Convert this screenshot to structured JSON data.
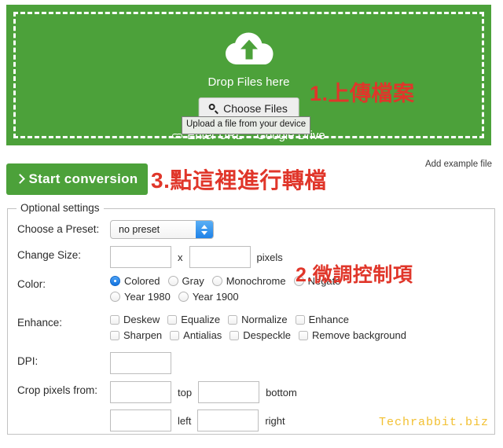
{
  "upload": {
    "icon": "cloud-upload-icon",
    "drop_label": "Drop Files here",
    "choose_files_label": "Choose Files",
    "choose_files_icon": "search-icon",
    "sources": [
      {
        "label": "Enter URL",
        "icon": "link-icon"
      },
      {
        "label": "Google Drive",
        "icon": "drive-icon"
      }
    ],
    "tooltip": "Upload a file from your device",
    "green": "#4ca13a"
  },
  "actions": {
    "start_conversion_label": "Start conversion",
    "start_conversion_icon": "chevron-right-icon",
    "add_example_file_label": "Add example file"
  },
  "annotations": {
    "accent": "#e0362a",
    "step1": "1.上傳檔案",
    "step2": "2.微調控制項",
    "step3": "3.點這裡進行轉檔"
  },
  "settings": {
    "legend": "Optional settings",
    "preset": {
      "label": "Choose a Preset:",
      "value": "no preset"
    },
    "change_size": {
      "label": "Change Size:",
      "width_value": "",
      "height_value": "",
      "separator": "x",
      "unit": "pixels"
    },
    "color": {
      "label": "Color:",
      "options": [
        {
          "name": "Colored",
          "checked": true
        },
        {
          "name": "Gray",
          "checked": false
        },
        {
          "name": "Monochrome",
          "checked": false
        },
        {
          "name": "Negate",
          "checked": false
        },
        {
          "name": "Year 1980",
          "checked": false
        },
        {
          "name": "Year 1900",
          "checked": false
        }
      ]
    },
    "enhance": {
      "label": "Enhance:",
      "options": [
        {
          "name": "Deskew",
          "checked": false
        },
        {
          "name": "Equalize",
          "checked": false
        },
        {
          "name": "Normalize",
          "checked": false
        },
        {
          "name": "Enhance",
          "checked": false
        },
        {
          "name": "Sharpen",
          "checked": false
        },
        {
          "name": "Antialias",
          "checked": false
        },
        {
          "name": "Despeckle",
          "checked": false
        },
        {
          "name": "Remove background",
          "checked": false
        }
      ]
    },
    "dpi": {
      "label": "DPI:",
      "value": ""
    },
    "crop": {
      "label": "Crop pixels from:",
      "top_value": "",
      "top_unit": "top",
      "bottom_value": "",
      "bottom_unit": "bottom",
      "left_value": "",
      "left_unit": "left",
      "right_value": "",
      "right_unit": "right"
    }
  },
  "watermark": "Techrabbit.biz"
}
